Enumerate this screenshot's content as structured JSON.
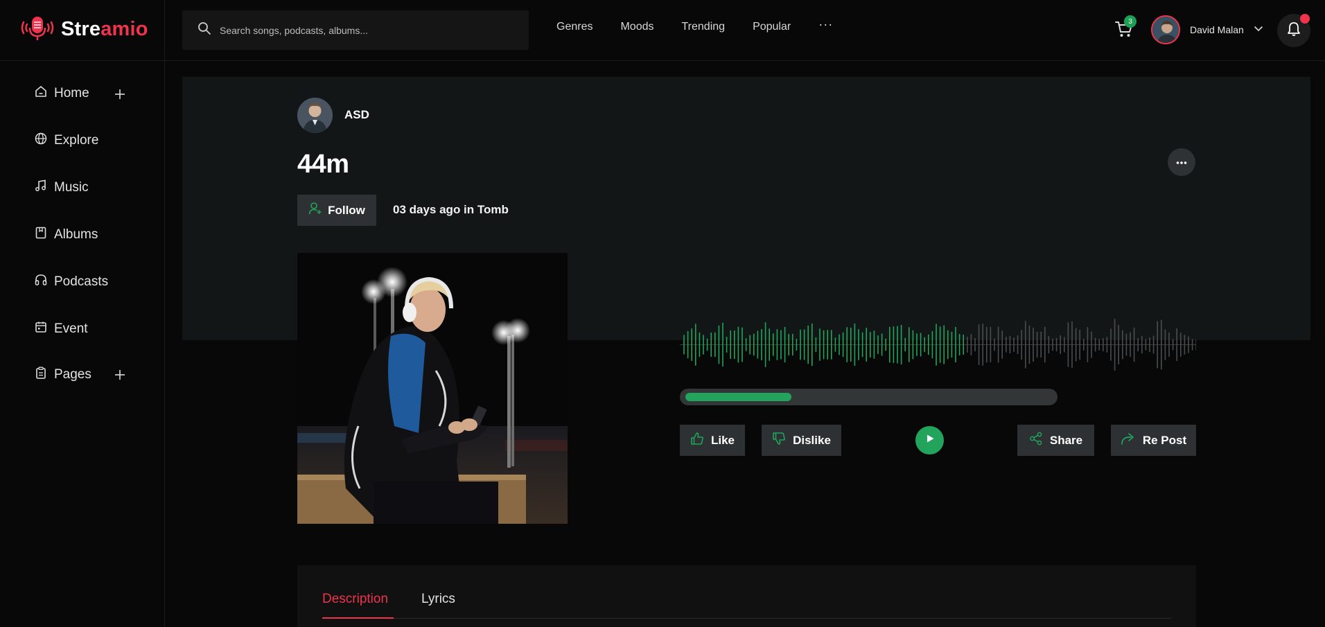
{
  "brand": {
    "name_part1": "Stre",
    "name_part2": "amio"
  },
  "search": {
    "placeholder": "Search songs, podcasts, albums..."
  },
  "topnav": {
    "items": [
      {
        "label": "Genres"
      },
      {
        "label": "Moods"
      },
      {
        "label": "Trending"
      },
      {
        "label": "Popular"
      }
    ],
    "more_label": "···"
  },
  "cart": {
    "count": "3"
  },
  "user": {
    "name": "David Malan"
  },
  "sidebar": {
    "items": [
      {
        "label": "Home",
        "icon": "home-icon"
      },
      {
        "label": "Explore",
        "icon": "globe-icon"
      },
      {
        "label": "Music",
        "icon": "music-note-icon"
      },
      {
        "label": "Albums",
        "icon": "album-icon"
      },
      {
        "label": "Podcasts",
        "icon": "headphones-icon"
      },
      {
        "label": "Event",
        "icon": "calendar-icon"
      },
      {
        "label": "Pages",
        "icon": "clipboard-icon"
      }
    ]
  },
  "track": {
    "artist": "ASD",
    "title": "44m",
    "follow_label": "Follow",
    "meta": "03 days ago in Tomb",
    "progress": 0.29
  },
  "actions": {
    "like": "Like",
    "dislike": "Dislike",
    "share": "Share",
    "repost": "Re Post"
  },
  "tabs": [
    {
      "label": "Description",
      "active": true
    },
    {
      "label": "Lyrics",
      "active": false
    }
  ],
  "colors": {
    "accent": "#f0344d",
    "green": "#22a45d",
    "hero_bg": "#131617",
    "button_bg": "#2d3133"
  }
}
